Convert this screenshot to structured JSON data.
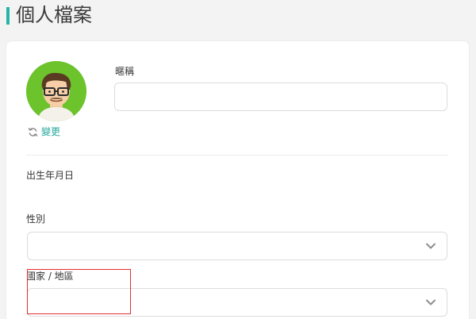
{
  "header": {
    "title": "個人檔案",
    "accent_color": "#27b3a8"
  },
  "profile": {
    "avatar_icon": "avatar-icon",
    "change_label": "變更",
    "change_icon": "refresh-icon",
    "link_color": "#27a79d"
  },
  "form": {
    "nickname_label": "暱稱",
    "nickname_value": "",
    "dob_label": "出生年月日",
    "gender_label": "性別",
    "gender_value": "",
    "country_label": "國家 / 地區",
    "country_value": "",
    "dropdown_icon": "chevron-down-icon"
  },
  "annotation": {
    "highlight_color": "#e52d2d"
  }
}
